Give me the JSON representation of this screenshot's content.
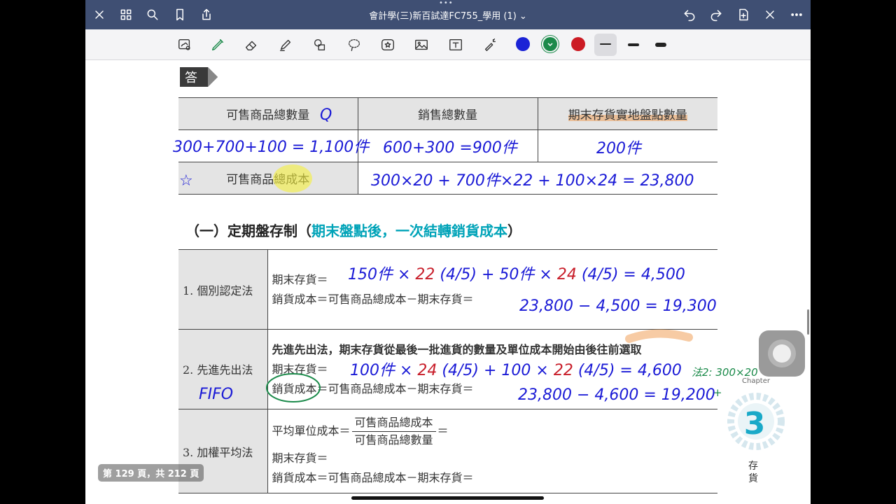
{
  "topbar": {
    "title": "會計學(三)新百試達FC755_學用 (1) ⌄",
    "left_icons": [
      "close-icon",
      "grid-icon",
      "search-icon",
      "bookmark-icon",
      "share-icon"
    ],
    "right_icons": [
      "undo-icon",
      "redo-icon",
      "add-page-icon",
      "no-pen-icon",
      "more-icon"
    ]
  },
  "toolbar": {
    "tools": [
      "lasso-icon",
      "pen-icon",
      "eraser-icon",
      "highlighter-icon",
      "shapes-icon",
      "lasso-select-icon",
      "sticker-icon",
      "image-icon",
      "text-icon",
      "laser-icon"
    ],
    "colors": [
      "#1b23d6",
      "#1b8a4a",
      "#cc1b24"
    ]
  },
  "answer_badge": "答",
  "table1": {
    "headers": [
      "可售商品總數量",
      "銷售總數量",
      "期末存貨實地盤點數量"
    ],
    "row2_label": "可售商品總成本"
  },
  "section": {
    "title_prefix": "（一）定期盤存制（",
    "title_cyan": "期末盤點後，一次結轉銷貨成本",
    "title_suffix": "）"
  },
  "table2": {
    "rows": [
      {
        "label": "1. 個別認定法",
        "lines": [
          "期末存貨＝",
          "銷貨成本＝可售商品總成本－期末存貨＝"
        ]
      },
      {
        "label": "2. 先進先出法",
        "bold_line": "先進先出法，期末存貨從最後一批進貨的數量及單位成本開始由後往前選取",
        "lines": [
          "期末存貨＝",
          "銷貨成本＝可售商品總成本－期末存貨＝"
        ]
      },
      {
        "label": "3. 加權平均法",
        "avg_prefix": "平均單位成本＝",
        "frac_num": "可售商品總成本",
        "frac_den": "可售商品總數量",
        "eq": "＝",
        "lines": [
          "期末存貨＝",
          "銷貨成本＝可售商品總成本－期末存貨＝"
        ]
      }
    ]
  },
  "page_indicator": "第 129 頁，共 212 頁",
  "chapter": {
    "word": "Chapter",
    "number": "3",
    "name1": "存",
    "name2": "貨"
  },
  "handwriting": {
    "t1_q": "Q",
    "t1_c1": "300+700+100 = 1,100件",
    "t1_c2": "600+300 =900件",
    "t1_c3": "200件",
    "t1_star": "☆",
    "t1_cost": "300×20 + 700件×22 + 100×24 = 23,800",
    "r1_a": "150件 ×",
    "r1_red1": "22",
    "r1_b": "(4/5) + 50件 ×",
    "r1_red2": "24",
    "r1_c": "(4/5) = 4,500",
    "r1_cogs": "23,800 − 4,500 = 19,300",
    "r2_a": "100件 ×",
    "r2_red1": "24",
    "r2_b": "(4/5) + 100 ×",
    "r2_red2": "22",
    "r2_c": "(4/5) = 4,600",
    "r2_cogs": "23,800 − 4,600 = 19,200",
    "fifo": "FIFO",
    "margin_note1": "法2: 300×20",
    "margin_note2": "+"
  }
}
